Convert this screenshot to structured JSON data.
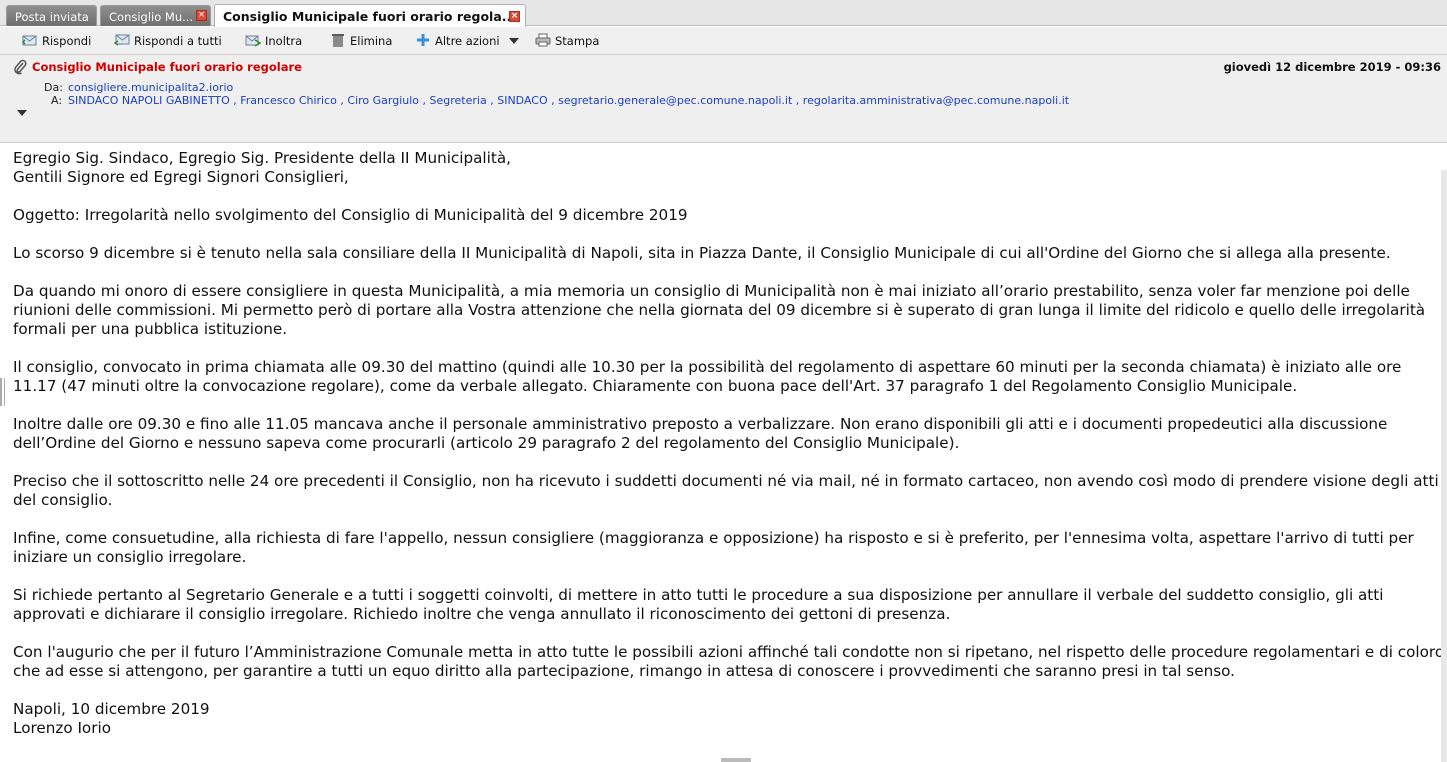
{
  "tabs": [
    {
      "label": "Posta inviata",
      "closable": false
    },
    {
      "label": "Consiglio Mu...",
      "closable": true
    },
    {
      "label": "Consiglio Municipale fuori orario regola...",
      "closable": true,
      "active": true
    }
  ],
  "toolbar": {
    "reply": "Rispondi",
    "reply_all": "Rispondi a tutti",
    "forward": "Inoltra",
    "delete": "Elimina",
    "more": "Altre azioni",
    "print": "Stampa"
  },
  "message": {
    "subject": "Consiglio Municipale fuori orario regolare",
    "date": "giovedì 12 dicembre 2019 - 09:36",
    "from_label": "Da:",
    "from": "consigliere.municipalita2.iorio",
    "to_label": "A:",
    "recipients": [
      "SINDACO NAPOLI GABINETTO",
      "Francesco Chirico",
      "Ciro Gargiulo",
      "Segreteria",
      "SINDACO",
      "segretario.generale@pec.comune.napoli.it",
      "regolarita.amministrativa@pec.comune.napoli.it"
    ],
    "separator": " , "
  },
  "body": {
    "greeting1": "Egregio Sig. Sindaco, Egregio Sig. Presidente della II Municipalità,",
    "greeting2": "Gentili Signore ed Egregi Signori Consiglieri,",
    "oggetto": "Oggetto: Irregolarità nello svolgimento del Consiglio di Municipalità del 9 dicembre 2019",
    "p1": "Lo scorso 9 dicembre si è tenuto nella sala consiliare della II Municipalità di Napoli, sita in Piazza Dante, il Consiglio Municipale di cui all'Ordine del Giorno che si allega alla presente.",
    "p2": "Da quando mi onoro di essere consigliere in questa Municipalità, a mia memoria un consiglio di Municipalità non è mai iniziato all’orario prestabilito, senza voler far menzione poi delle riunioni delle commissioni. Mi permetto però di portare alla Vostra attenzione che nella giornata del 09 dicembre si è superato di gran lunga il limite del ridicolo e quello delle irregolarità formali per una pubblica istituzione.",
    "p3": "Il consiglio, convocato in prima chiamata alle 09.30 del mattino (quindi alle 10.30 per la possibilità del regolamento di aspettare 60 minuti per la seconda chiamata) è iniziato alle ore 11.17 (47 minuti oltre la convocazione regolare), come da verbale allegato. Chiaramente con buona pace dell'Art. 37 paragrafo 1 del Regolamento Consiglio Municipale.",
    "p4": "Inoltre dalle ore 09.30 e fino alle 11.05 mancava anche il personale amministrativo preposto a verbalizzare. Non erano disponibili gli atti e i documenti propedeutici alla discussione dell’Ordine del Giorno e nessuno sapeva come procurarli (articolo 29 paragrafo 2 del regolamento del Consiglio Municipale).",
    "p5": "Preciso che il sottoscritto nelle 24 ore precedenti il Consiglio, non ha ricevuto i suddetti documenti né via mail, né in formato cartaceo, non avendo così modo di prendere visione degli atti del consiglio.",
    "p6": "Infine, come consuetudine, alla richiesta di fare l'appello, nessun consigliere (maggioranza e opposizione) ha risposto e si è preferito, per l'ennesima volta, aspettare l'arrivo di tutti per iniziare un consiglio irregolare.",
    "p7": "Si richiede pertanto al Segretario Generale e a tutti i soggetti coinvolti, di mettere in atto tutti le procedure a sua disposizione per annullare il verbale del suddetto consiglio, gli atti approvati e dichiarare il consiglio irregolare. Richiedo inoltre che venga annullato il riconoscimento dei gettoni di presenza.",
    "p8": "Con l'augurio che per il futuro l’Amministrazione Comunale metta in atto tutte le possibili azioni affinché tali condotte non si ripetano, nel rispetto delle procedure regolamentari e di coloro che ad esse si attengono, per garantire a tutti un equo diritto alla partecipazione, rimango in attesa di conoscere i provvedimenti che saranno presi in tal senso.",
    "place_date": "Napoli, 10 dicembre 2019",
    "signature": "Lorenzo Iorio"
  }
}
